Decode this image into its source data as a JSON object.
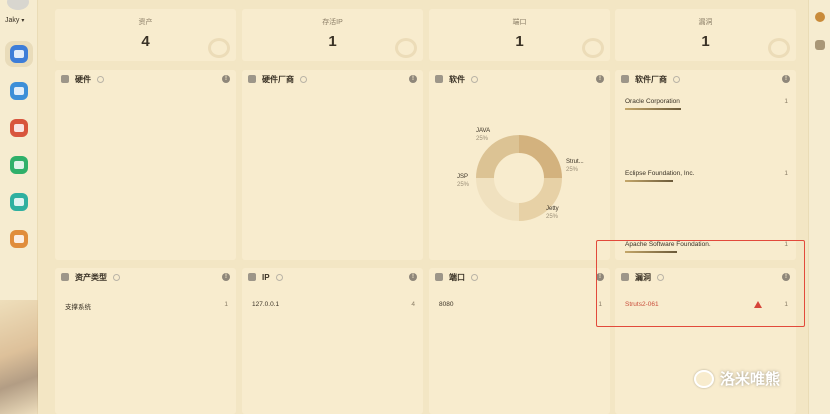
{
  "sidebar": {
    "user": "Jaky",
    "nav": [
      {
        "icon": "asset-icon",
        "color": "#3d7dd8"
      },
      {
        "icon": "list-icon",
        "color": "#3d8fd8"
      },
      {
        "icon": "screen-icon",
        "color": "#d8553d"
      },
      {
        "icon": "chart-icon",
        "color": "#2fb06a"
      },
      {
        "icon": "chat-icon",
        "color": "#2fb0a0"
      },
      {
        "icon": "card-icon",
        "color": "#e08d3c"
      }
    ]
  },
  "stats": [
    {
      "label": "资产",
      "value": "4"
    },
    {
      "label": "存活IP",
      "value": "1"
    },
    {
      "label": "端口",
      "value": "1"
    },
    {
      "label": "漏洞",
      "value": "1"
    }
  ],
  "panels": {
    "hardware": {
      "title": "硬件"
    },
    "hw_vendor": {
      "title": "硬件厂商"
    },
    "software": {
      "title": "软件",
      "chart_data": {
        "type": "pie",
        "donut": true,
        "categories": [
          "JAVA",
          "Strut...",
          "Jetty",
          "JSP"
        ],
        "values": [
          25,
          25,
          25,
          25
        ],
        "labels": [
          "25%",
          "25%",
          "25%",
          "25%"
        ],
        "colors": [
          "#d3b27e",
          "#e7d1a6",
          "#f0e1bf",
          "#dcc394"
        ]
      }
    },
    "sw_vendor": {
      "title": "软件厂商",
      "items": [
        {
          "name": "Oracle Corporation",
          "count": "1"
        },
        {
          "name": "Eclipse Foundation, Inc.",
          "count": "1"
        },
        {
          "name": "Apache Software Foundation.",
          "count": "1"
        }
      ]
    },
    "asset_type": {
      "title": "资产类型",
      "items": [
        {
          "name": "支撑系统",
          "count": "1"
        }
      ]
    },
    "ip": {
      "title": "IP",
      "items": [
        {
          "name": "127.0.0.1",
          "count": "4"
        }
      ]
    },
    "port": {
      "title": "端口",
      "items": [
        {
          "name": "8080",
          "count": "1"
        }
      ]
    },
    "vuln": {
      "title": "漏洞",
      "items": [
        {
          "name": "Struts2-061",
          "count": "1"
        }
      ]
    }
  },
  "info_glyph": "!",
  "watermark": "洛米唯熊"
}
